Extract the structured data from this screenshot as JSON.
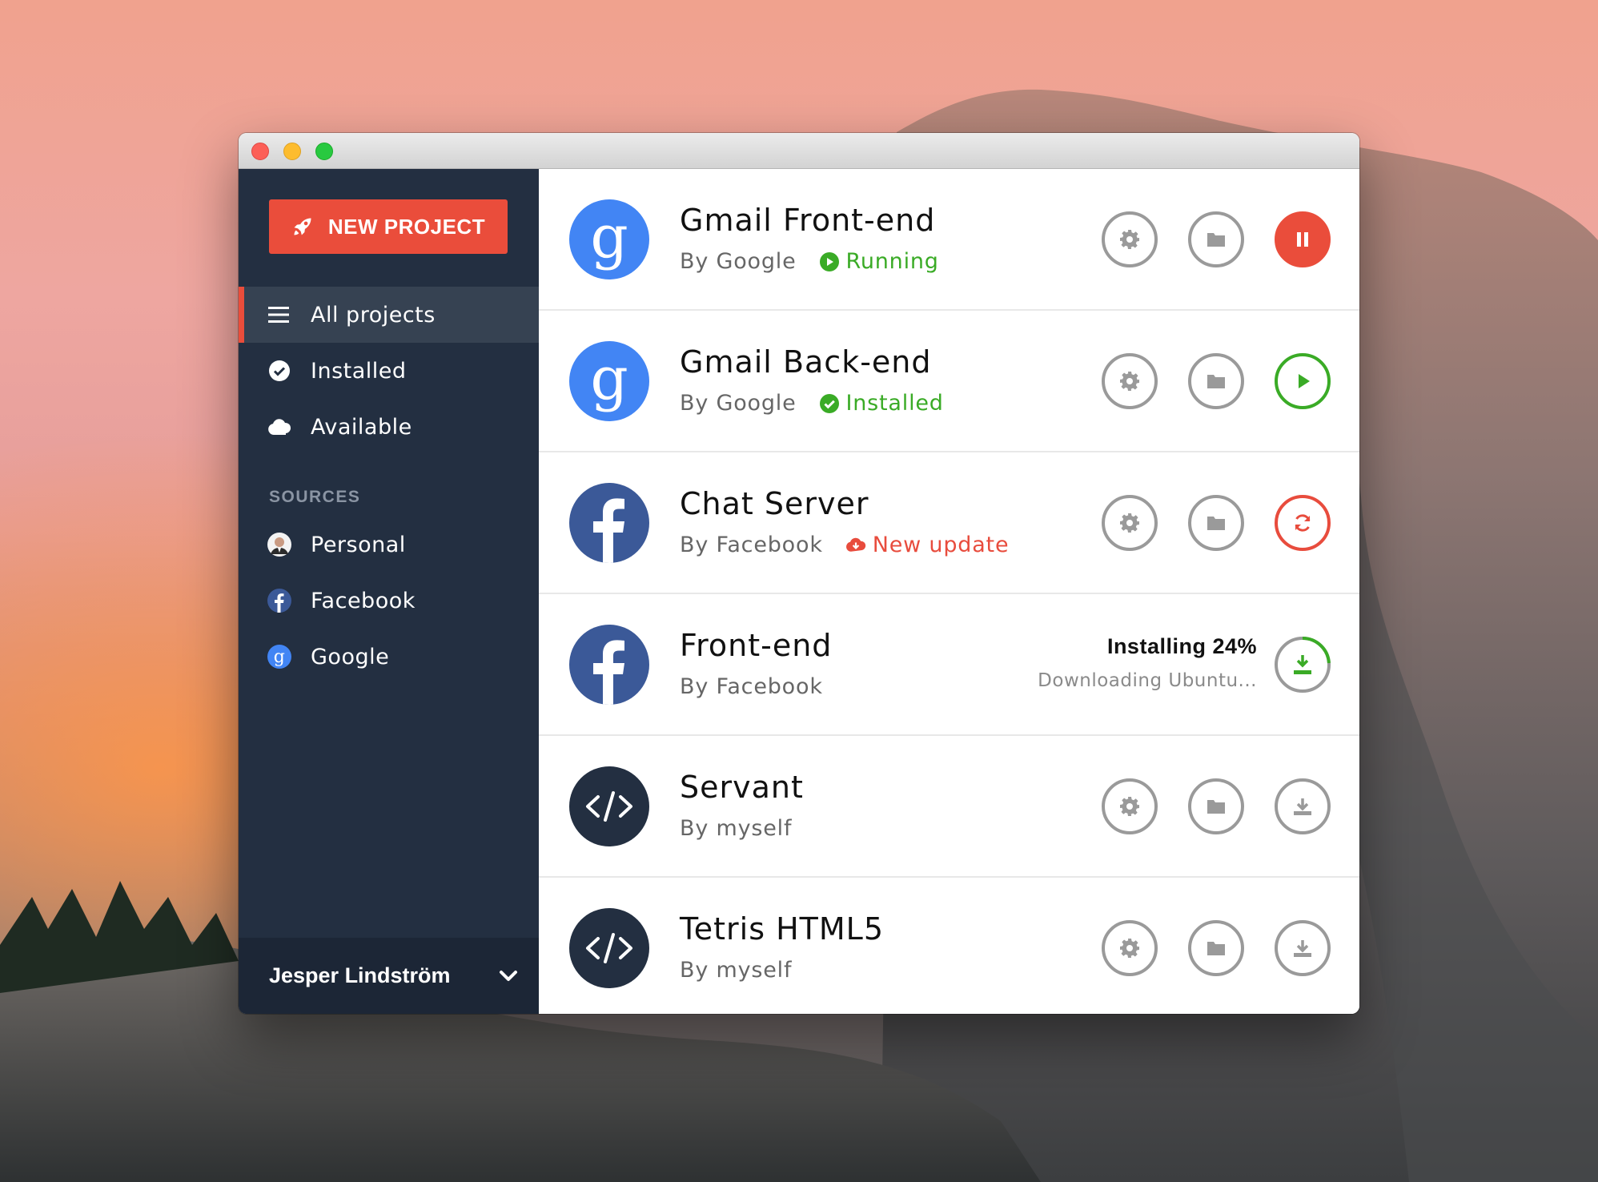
{
  "colors": {
    "accent": "#ea4d3b",
    "sidebar_bg": "#232f41",
    "success": "#3aab26",
    "danger": "#e84c3d",
    "google_blue": "#4285f4",
    "facebook_blue": "#3b5998"
  },
  "sidebar": {
    "new_project_label": "NEW PROJECT",
    "nav": [
      {
        "label": "All projects",
        "icon": "menu-icon"
      },
      {
        "label": "Installed",
        "icon": "check-circle-icon"
      },
      {
        "label": "Available",
        "icon": "cloud-icon"
      }
    ],
    "sources_heading": "SOURCES",
    "sources": [
      {
        "label": "Personal",
        "icon": "user-avatar-icon"
      },
      {
        "label": "Facebook",
        "icon": "facebook-icon"
      },
      {
        "label": "Google",
        "icon": "google-icon"
      }
    ],
    "user_name": "Jesper Lindström"
  },
  "projects": [
    {
      "name": "Gmail Front-end",
      "author": "By Google",
      "status": "Running",
      "source": "google",
      "action": "pause"
    },
    {
      "name": "Gmail Back-end",
      "author": "By Google",
      "status": "Installed",
      "source": "google",
      "action": "play"
    },
    {
      "name": "Chat Server",
      "author": "By Facebook",
      "status": "New update",
      "source": "facebook",
      "action": "update"
    },
    {
      "name": "Front-end",
      "author": "By Facebook",
      "install_title": "Installing 24%",
      "install_detail": "Downloading Ubuntu...",
      "install_progress": 0.24,
      "source": "facebook",
      "action": "installing"
    },
    {
      "name": "Servant",
      "author": "By myself",
      "source": "code",
      "action": "download"
    },
    {
      "name": "Tetris HTML5",
      "author": "By myself",
      "source": "code",
      "action": "download"
    }
  ]
}
